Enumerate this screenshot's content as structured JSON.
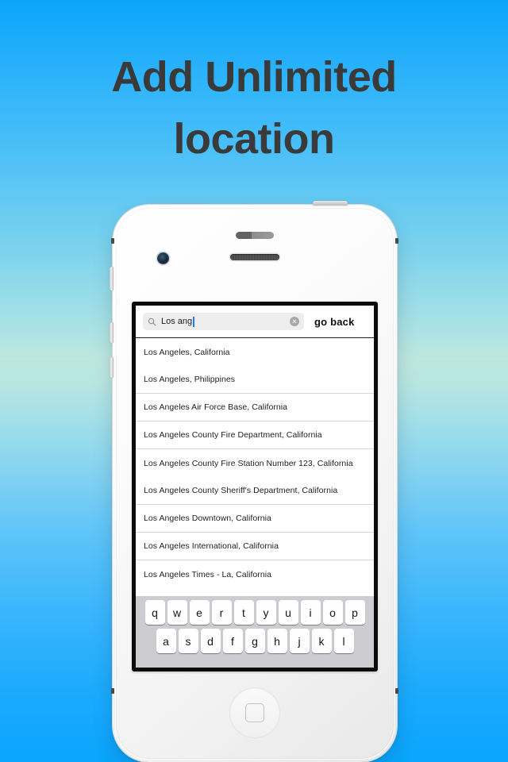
{
  "headline": {
    "line1": "Add Unlimited",
    "line2": "location"
  },
  "device": {
    "name": "white-smartphone",
    "body_color": "#ffffff",
    "bezel_color": "#0b0b0b"
  },
  "screen": {
    "search": {
      "icon": "search-icon",
      "value": "Los ang",
      "placeholder": "Search",
      "clear_icon": "clear-circle-icon",
      "caret_color": "#1a7df5",
      "field_background": "#ededed"
    },
    "go_back_label": "go back",
    "suggestions": [
      {
        "label": "Los Angeles, California",
        "divider": false
      },
      {
        "label": "Los Angeles, Philippines",
        "divider": true
      },
      {
        "label": "Los Angeles Air Force Base, California",
        "divider": true
      },
      {
        "label": "Los Angeles County Fire Department, California",
        "divider": true
      },
      {
        "label": "Los Angeles County Fire Station Number 123, California",
        "divider": false
      },
      {
        "label": "Los Angeles County Sheriff's Department, California",
        "divider": true
      },
      {
        "label": "Los Angeles Downtown, California",
        "divider": true
      },
      {
        "label": "Los Angeles International, California",
        "divider": true
      },
      {
        "label": "Los Angeles Times - La, California",
        "divider": false
      }
    ],
    "keyboard": {
      "background": "#ccccd1",
      "rows": [
        [
          "q",
          "w",
          "e",
          "r",
          "t",
          "y",
          "u",
          "i",
          "o",
          "p"
        ],
        [
          "a",
          "s",
          "d",
          "f",
          "g",
          "h",
          "j",
          "k",
          "l"
        ]
      ]
    }
  },
  "hardware": {
    "proximity_sensor": "proximity-sensor",
    "front_camera": "front-camera-icon",
    "earpiece": "earpiece-speaker",
    "home_button": "home-button",
    "side_buttons": [
      "silent-switch",
      "volume-up-button",
      "volume-down-button"
    ],
    "power_button": "power-button"
  },
  "colors": {
    "background_top": "#0aa6fb",
    "background_mid": "#bde7e0",
    "background_bottom": "#0aa5fe",
    "headline_text": "#3a3a3a"
  }
}
